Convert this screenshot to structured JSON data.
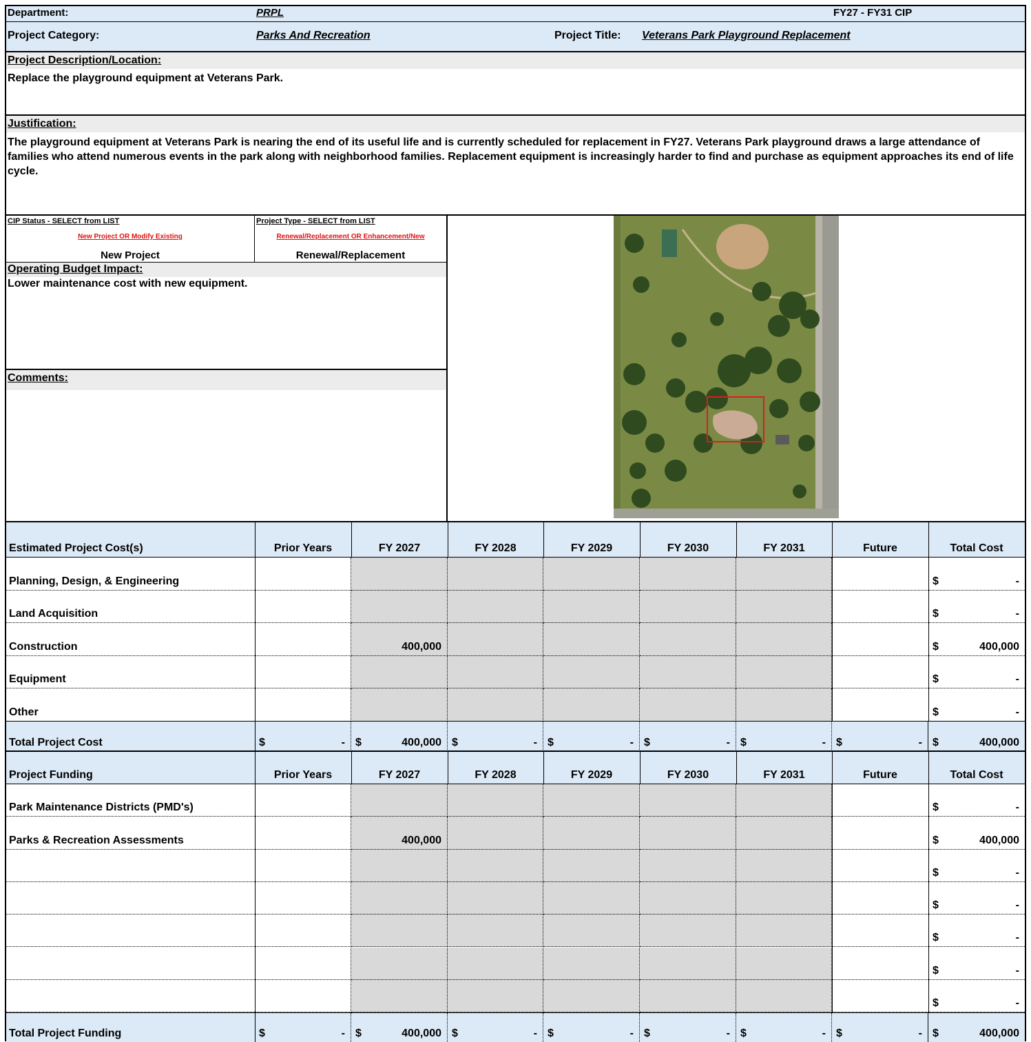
{
  "header": {
    "department_label": "Department:",
    "department_value": "PRPL",
    "cip_title": "FY27 - FY31 CIP",
    "category_label": "Project Category:",
    "category_value": "Parks And Recreation",
    "project_title_label": "Project Title:",
    "project_title_value": "Veterans Park Playground Replacement"
  },
  "description": {
    "label": "Project Description/Location:",
    "text": "Replace the playground equipment at Veterans Park."
  },
  "justification": {
    "label": "Justification:",
    "text": "The playground equipment at Veterans Park is nearing the end of its useful life and  is currently scheduled for replacement in FY27.  Veterans Park playground draws a large attendance of families who attend numerous events in the park along with neighborhood families.  Replacement equipment is increasingly harder to find and purchase as equipment approaches its end of life cycle."
  },
  "status": {
    "cip_label": "CIP Status - SELECT from LIST",
    "cip_hint": "New Project OR  Modify Existing",
    "cip_value": "New Project",
    "type_label": "Project Type - SELECT from LIST",
    "type_hint": "Renewal/Replacement OR Enhancement/New",
    "type_value": "Renewal/Replacement"
  },
  "operating": {
    "label": "Operating Budget Impact:",
    "text": "Lower maintenance cost with new equipment."
  },
  "comments": {
    "label": "Comments:",
    "text": ""
  },
  "map": {
    "alt": "aerial-photo-veterans-park"
  },
  "colors": {
    "header_blue": "#dce9f6",
    "section_grey": "#ececec",
    "shaded_cell": "#d9d9d9",
    "hint_red": "#e01010",
    "highlight_box": "#d42020"
  },
  "cost_table": {
    "title": "Estimated Project Cost(s)",
    "columns": [
      "Prior Years",
      "FY 2027",
      "FY 2028",
      "FY 2029",
      "FY 2030",
      "FY 2031",
      "Future",
      "Total Cost"
    ],
    "rows": [
      {
        "label": "Planning, Design, & Engineering",
        "values": [
          "",
          "",
          "",
          "",
          "",
          "",
          ""
        ],
        "total": "-"
      },
      {
        "label": "Land Acquisition",
        "values": [
          "",
          "",
          "",
          "",
          "",
          "",
          ""
        ],
        "total": "-"
      },
      {
        "label": "Construction",
        "values": [
          "",
          "400,000",
          "",
          "",
          "",
          "",
          ""
        ],
        "total": "400,000"
      },
      {
        "label": "Equipment",
        "values": [
          "",
          "",
          "",
          "",
          "",
          "",
          ""
        ],
        "total": "-"
      },
      {
        "label": "Other",
        "values": [
          "",
          "",
          "",
          "",
          "",
          "",
          ""
        ],
        "total": "-"
      }
    ],
    "total_label": "Total Project Cost",
    "totals": [
      "-",
      "400,000",
      "-",
      "-",
      "-",
      "-",
      "-",
      "400,000"
    ]
  },
  "funding_table": {
    "title": "Project Funding",
    "columns": [
      "Prior Years",
      "FY 2027",
      "FY 2028",
      "FY 2029",
      "FY 2030",
      "FY 2031",
      "Future",
      "Total Cost"
    ],
    "rows": [
      {
        "label": "Park Maintenance Districts (PMD's)",
        "values": [
          "",
          "",
          "",
          "",
          "",
          "",
          ""
        ],
        "total": "-"
      },
      {
        "label": "Parks & Recreation Assessments",
        "values": [
          "",
          "400,000",
          "",
          "",
          "",
          "",
          ""
        ],
        "total": "400,000"
      },
      {
        "label": "",
        "values": [
          "",
          "",
          "",
          "",
          "",
          "",
          ""
        ],
        "total": "-"
      },
      {
        "label": "",
        "values": [
          "",
          "",
          "",
          "",
          "",
          "",
          ""
        ],
        "total": "-"
      },
      {
        "label": "",
        "values": [
          "",
          "",
          "",
          "",
          "",
          "",
          ""
        ],
        "total": "-"
      },
      {
        "label": "",
        "values": [
          "",
          "",
          "",
          "",
          "",
          "",
          ""
        ],
        "total": "-"
      },
      {
        "label": "",
        "values": [
          "",
          "",
          "",
          "",
          "",
          "",
          ""
        ],
        "total": "-"
      }
    ],
    "total_label": "Total Project Funding",
    "totals": [
      "-",
      "400,000",
      "-",
      "-",
      "-",
      "-",
      "-",
      "400,000"
    ]
  },
  "currency_symbol": "$"
}
